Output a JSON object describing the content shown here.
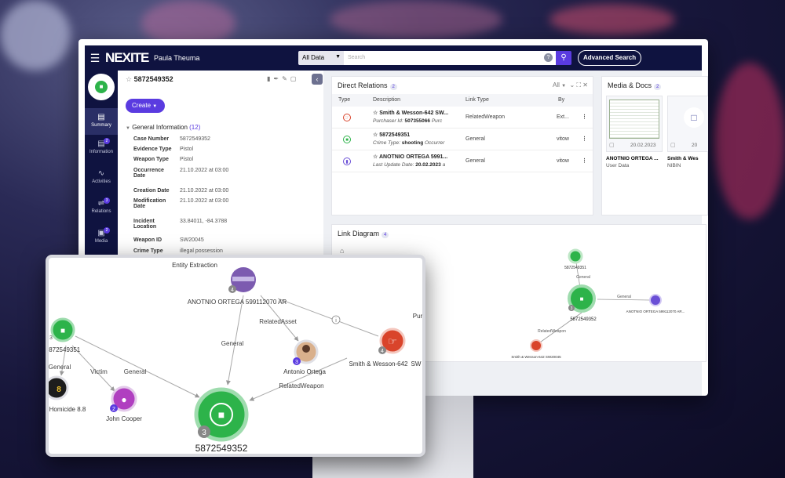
{
  "app": {
    "logo": "NEXITE",
    "user_name": "Paula Theuma",
    "filter": "All Data",
    "search_placeholder": "Search",
    "help": "?",
    "advanced_search": "Advanced Search"
  },
  "sidebar": {
    "items": [
      {
        "label": "Summary",
        "icon": "bar-chart-icon",
        "badge": ""
      },
      {
        "label": "Information",
        "icon": "info-icon",
        "badge": "2"
      },
      {
        "label": "Activities",
        "icon": "activity-icon",
        "badge": ""
      },
      {
        "label": "Relations",
        "icon": "relations-icon",
        "badge": "3"
      },
      {
        "label": "Media",
        "icon": "media-icon",
        "badge": "2"
      }
    ]
  },
  "entity": {
    "id": "5872549352",
    "create_label": "Create",
    "section_title": "General Information",
    "section_count": "(12)",
    "fields": [
      {
        "k": "Case Number",
        "v": "5872549352"
      },
      {
        "k": "Evidence Type",
        "v": "Pistol"
      },
      {
        "k": "Weapon Type",
        "v": "Pistol"
      },
      {
        "k": "Occurrence Date",
        "v": "21.10.2022 at 03:00"
      },
      {
        "k": "Creation Date",
        "v": "21.10.2022 at 03:00"
      },
      {
        "k": "Modification Date",
        "v": "21.10.2022 at 03:00"
      },
      {
        "k": "Incident Location",
        "v": "33.84011, -84.3788"
      },
      {
        "k": "Weapon ID",
        "v": "SW20045"
      },
      {
        "k": "Crime Type",
        "v": "illegal possession"
      }
    ]
  },
  "direct_relations": {
    "title": "Direct Relations",
    "count": "2",
    "filter": "All",
    "columns": [
      "Type",
      "Description",
      "Link Type",
      "By"
    ],
    "rows": [
      {
        "title": "Smith & Wesson-642 SW...",
        "sub_label": "Purchaser Id:",
        "sub_value": "507355066",
        "sub_rest": "Purc",
        "link_type": "RelatedWeapon",
        "by": "Ext...",
        "color": "#d9442b"
      },
      {
        "title": "5872549351",
        "sub_label": "Crime Type:",
        "sub_value": "shooting",
        "sub_rest": "Occurrer",
        "link_type": "General",
        "by": "vitow",
        "color": "#2db34a"
      },
      {
        "title": "ANOTNIO ORTEGA 5991...",
        "sub_label": "Last Update Date:",
        "sub_value": "20.02.2023",
        "sub_rest": "a",
        "link_type": "General",
        "by": "vitow",
        "color": "#6a4fd6"
      }
    ]
  },
  "media": {
    "title": "Media & Docs",
    "count": "2",
    "items": [
      {
        "date": "20.02.2023",
        "name": "ANOTNIO ORTEGA ...",
        "source": "User Data"
      },
      {
        "date": "20",
        "name": "Smith & Wes",
        "source": "NIBIN"
      }
    ]
  },
  "link_diagram": {
    "title": "Link Diagram",
    "count": "4",
    "nodes": {
      "top": "5872549351",
      "center": "5872549352",
      "right": "ANOTNIO ORTEGA 599112070 AR...",
      "bottom": "Smith & Wesson-642 SW20045"
    },
    "edges": {
      "top": "General",
      "right": "General",
      "bottom": "RelatedWeapon"
    },
    "center_badge": "3"
  },
  "zoom": {
    "nodes": {
      "entity_extraction": "Entity Extraction",
      "ortega": "ANOTNIO ORTEGA 599112070 AR",
      "case1": "5872549351",
      "case2": "5872549352",
      "antonio": "Antonio Ortega",
      "smith": "Smith & Wesson-642",
      "smith_tail": "SW",
      "john": "John Cooper",
      "homicide": "Homicide 8.8",
      "purchase": "Pur"
    },
    "edges": {
      "related_asset": "RelatedAsset",
      "general_a": "General",
      "general_b": "General",
      "general_c": "General",
      "victim": "Victim",
      "related_weapon": "RelatedWeapon",
      "info": "i"
    },
    "badges": {
      "ortega": "4",
      "antonio": "3",
      "smith": "4",
      "john": "2",
      "center": "3",
      "case1": "3"
    }
  }
}
